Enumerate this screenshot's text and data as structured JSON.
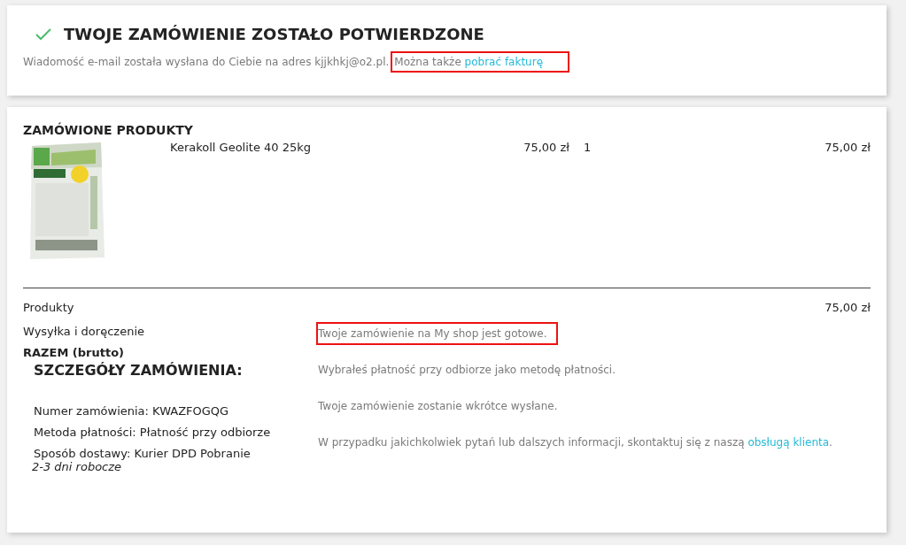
{
  "confirmation": {
    "title": "TWOJE ZAMÓWIENIE ZOSTAŁO POTWIERDZONE",
    "message": "Wiadomość e-mail została wysłana do Ciebie na adres kjjkhkj@o2.pl.",
    "invoice_prefix": "Można także",
    "invoice_link": "pobrać fakturę",
    "highlighted": true
  },
  "products": {
    "title": "ZAMÓWIONE PRODUKTY",
    "items": [
      {
        "name": "Kerakoll Geolite 40 25kg",
        "unit_price": "75,00 zł",
        "quantity": "1",
        "total": "75,00 zł"
      }
    ]
  },
  "summary": [
    {
      "label": "Produkty",
      "value": "75,00 zł",
      "bold": false
    },
    {
      "label": "Wysyłka i doręczenie",
      "bold": false
    },
    {
      "label": "RAZEM (brutto)",
      "bold": true
    }
  ],
  "details": {
    "title": "SZCZEGÓŁY ZAMÓWIENIA:",
    "lines": [
      "Numer zamówienia: KWAZFOGQG",
      "Metoda płatności: Płatność przy odbiorze",
      "Sposób dostawy: Kurier DPD Pobranie"
    ],
    "note": "2-3 dni robocze"
  },
  "messages": [
    {
      "text": "Twoje zamówienie na My shop jest gotowe.",
      "highlighted": true
    },
    {
      "text": "Wybrałeś płatność przy odbiorze jako metodę płatności.",
      "highlighted": false
    },
    {
      "text": "Twoje zamówienie zostanie wkrótce wysłane.",
      "highlighted": false
    },
    {
      "text": "W przypadku jakichkolwiek pytań lub dalszych informacji, skontaktuj się z naszą",
      "link": "obsługą klienta",
      "suffix": ".",
      "highlighted": false
    }
  ]
}
